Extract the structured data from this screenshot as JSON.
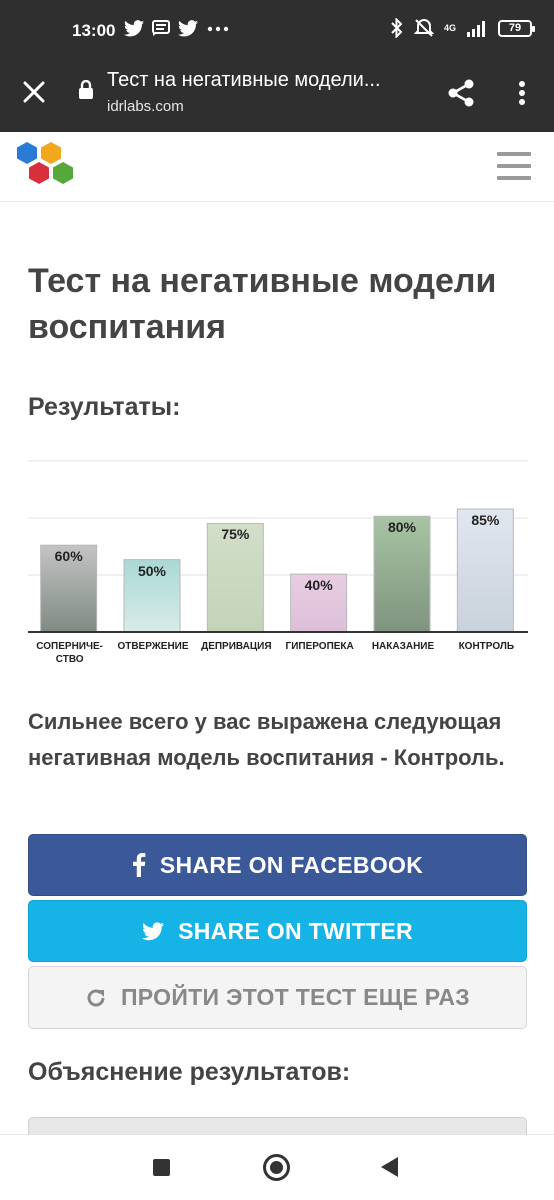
{
  "status_bar": {
    "time": "13:00",
    "notification_icons": [
      "twitter-icon",
      "message-icon",
      "twitter-icon",
      "more-dots-icon"
    ],
    "network_label": "4G",
    "battery": "79"
  },
  "browser": {
    "page_title": "Тест на негативные модели...",
    "url": "idrlabs.com"
  },
  "colors": {
    "facebook": "#3b5998",
    "twitter": "#16b4e6",
    "dark_bar": "#2f2f2f"
  },
  "page": {
    "title": "Тест на негативные модели воспитания",
    "results_heading": "Результаты:",
    "summary": "Сильнее всего у вас выражена следующая негативная модель воспитания - Контроль.",
    "share_facebook": "SHARE ON FACEBOOK",
    "share_twitter": "SHARE ON TWITTER",
    "retry": "ПРОЙТИ ЭТОТ ТЕСТ ЕЩЕ РАЗ",
    "explanation_heading": "Объяснение результатов:"
  },
  "chart_data": {
    "type": "bar",
    "categories": [
      "СОПЕРНИЧЕ-\nСТВО",
      "ОТВЕРЖЕНИЕ",
      "ДЕПРИВАЦИЯ",
      "ГИПЕРОПЕКА",
      "НАКАЗАНИЕ",
      "КОНТРОЛЬ"
    ],
    "values": [
      60,
      50,
      75,
      40,
      80,
      85
    ],
    "value_labels": [
      "60%",
      "50%",
      "75%",
      "40%",
      "80%",
      "85%"
    ],
    "ylim": [
      0,
      100
    ],
    "bar_colors": [
      [
        "#c4c4c4",
        "#7f8a82"
      ],
      [
        "#aad8d4",
        "#d8ece9"
      ],
      [
        "#d2dec8",
        "#c4d3b8"
      ],
      [
        "#e8cde2",
        "#dcc0d8"
      ],
      [
        "#a7c4a3",
        "#7f947f"
      ],
      [
        "#e1e7ef",
        "#c9d1dc"
      ]
    ],
    "grid": true
  }
}
